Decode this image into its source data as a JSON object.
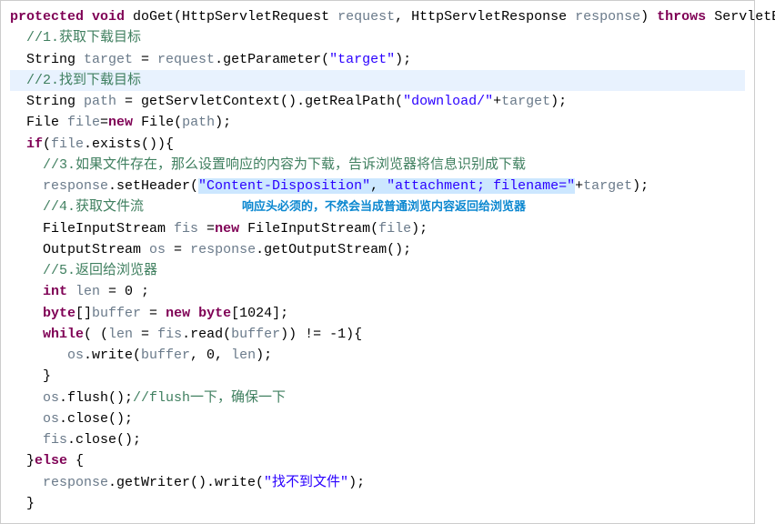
{
  "code": {
    "l1": {
      "kw1": "protected void",
      "mid": " doGet(HttpServletRequest ",
      "p1": "request",
      "mid2": ", HttpServletResponse ",
      "p2": "response",
      "mid3": ") ",
      "kw2": "throws",
      "end": " ServletException,"
    },
    "l2": "//1.获取下载目标",
    "l3": {
      "pre": "String ",
      "v1": "target",
      "mid": " = ",
      "v2": "request",
      "mid2": ".getParameter(",
      "s": "\"target\"",
      "end": ");"
    },
    "l4": "//2.找到下载目标",
    "l5": {
      "pre": "String ",
      "v1": "path",
      "mid": " = getServletContext().getRealPath(",
      "s": "\"download/\"",
      "plus": "+",
      "v2": "target",
      "end": ");"
    },
    "l6": {
      "pre": "File ",
      "v1": "file",
      "eq": "=",
      "kw": "new",
      "mid": " File(",
      "v2": "path",
      "end": ");"
    },
    "l7": {
      "kw": "if",
      "pre": "(",
      "v": "file",
      "end": ".exists()){"
    },
    "l8": "//3.如果文件存在，那么设置响应的内容为下载，告诉浏览器将信息识别成下载",
    "l9": {
      "v": "response",
      "mid": ".setHeader(",
      "s1": "\"Content-Disposition\"",
      "comma": ", ",
      "s2": "\"attachment; filename=\"",
      "plus": "+",
      "v2": "target",
      "end": ");"
    },
    "l10a": "//4.获取文件流",
    "anno": "响应头必须的，不然会当成普通浏览内容返回给浏览器",
    "l11": {
      "pre": "FileInputStream ",
      "v1": "fis",
      "mid": " =",
      "kw": "new",
      "mid2": " FileInputStream(",
      "v2": "file",
      "end": ");"
    },
    "l12": {
      "pre": "OutputStream ",
      "v1": "os",
      "mid": " = ",
      "v2": "response",
      "end": ".getOutputStream();"
    },
    "l13": "//5.返回给浏览器",
    "l14": {
      "kw": "int",
      "mid": " ",
      "v": "len",
      "end": " = 0 ;"
    },
    "l15": {
      "kw1": "byte",
      "mid1": "[]",
      "v": "buffer",
      "mid2": " = ",
      "kw2": "new byte",
      "end": "[1024];"
    },
    "l16": {
      "kw": "while",
      "pre": "( (",
      "v1": "len",
      "mid": " = ",
      "v2": "fis",
      "mid2": ".read(",
      "v3": "buffer",
      "end": ")) != -1){"
    },
    "l17": {
      "v1": "os",
      "mid": ".write(",
      "v2": "buffer",
      "mid2": ", 0, ",
      "v3": "len",
      "end": ");"
    },
    "l18": "}",
    "l19": {
      "v": "os",
      "mid": ".flush();",
      "cm": "//flush一下，确保一下"
    },
    "l20": {
      "v": "os",
      "end": ".close();"
    },
    "l21": {
      "v": "fis",
      "end": ".close();"
    },
    "l22": {
      "pre": "}",
      "kw": "else",
      "end": " {"
    },
    "l23": {
      "v": "response",
      "mid": ".getWriter().write(",
      "s": "\"找不到文件\"",
      "end": ");"
    },
    "l24": "}"
  }
}
